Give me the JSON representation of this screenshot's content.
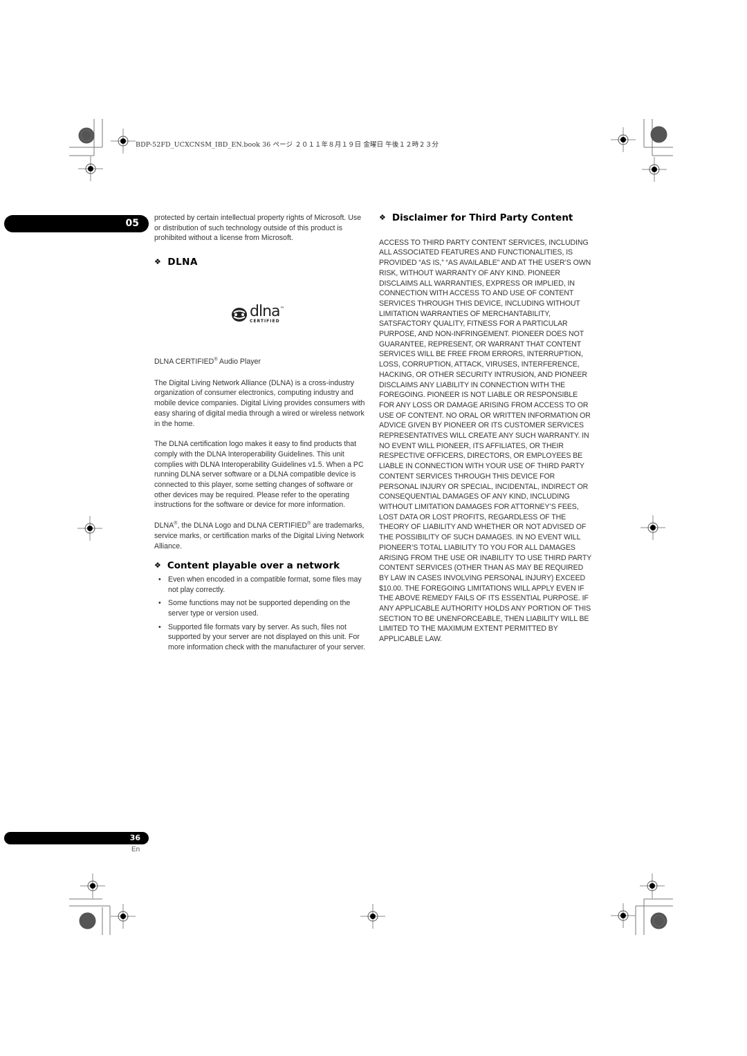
{
  "header": {
    "print_slug": "BDP-52FD_UCXCNSM_IBD_EN.book  36 ページ  ２０１１年８月１９日  金曜日  午後１２時２３分"
  },
  "chapter_tab": {
    "number": "05"
  },
  "footer": {
    "page_number": "36",
    "language": "En"
  },
  "left_column": {
    "intro_paragraph": "protected by certain intellectual property rights of Microsoft. Use or distribution of such technology outside of this product is prohibited without a license from Microsoft.",
    "dlna_section": {
      "heading": "DLNA",
      "logo": {
        "wordmark": "dlna",
        "trademark": "™",
        "subtitle": "CERTIFIED",
        "icon": "dlna-logo-icon"
      },
      "certified_label": "DLNA CERTIFIED",
      "certified_label_mark": "®",
      "certified_label_suffix": " Audio Player",
      "paragraphs": [
        "The Digital Living Network Alliance (DLNA) is a cross-industry organization of consumer electronics, computing industry and mobile device companies. Digital Living provides consumers with easy sharing of digital media through a wired or wireless network in the home.",
        "The DLNA certification logo makes it easy to find products that comply with the DLNA Interoperability Guidelines. This unit complies with DLNA Interoperability Guidelines v1.5. When a PC running DLNA server software or a DLNA compatible device is connected to this player, some setting changes of software or other devices may be required. Please refer to the operating instructions for the software or device for more information."
      ],
      "trademark_note": {
        "part1": "DLNA",
        "mark1": "®",
        "part2": ", the DLNA Logo and DLNA CERTIFIED",
        "mark2": "®",
        "part3": " are trademarks, service marks, or certification marks of the Digital Living Network Alliance."
      }
    },
    "network_section": {
      "heading": "Content playable over a network",
      "bullets": [
        "Even when encoded in a compatible format, some files may not play correctly.",
        "Some functions may not be supported depending on the server type or version used.",
        "Supported file formats vary by server. As such, files not supported by your server are not displayed on this unit. For more information check with the manufacturer of your server."
      ]
    }
  },
  "right_column": {
    "heading": "Disclaimer for Third Party Content",
    "body": "ACCESS TO THIRD PARTY CONTENT SERVICES, INCLUDING ALL ASSOCIATED FEATURES AND FUNCTIONALITIES, IS PROVIDED “AS IS,” “AS AVAILABLE” AND AT THE USER’S OWN RISK, WITHOUT WARRANTY OF ANY KIND. PIONEER DISCLAIMS ALL WARRANTIES, EXPRESS OR IMPLIED, IN CONNECTION WITH ACCESS TO AND USE OF CONTENT SERVICES THROUGH THIS DEVICE, INCLUDING WITHOUT LIMITATION WARRANTIES OF MERCHANTABILITY, SATSFACTORY QUALITY, FITNESS FOR A PARTICULAR PURPOSE, AND NON-INFRINGEMENT. PIONEER DOES NOT GUARANTEE, REPRESENT, OR WARRANT THAT CONTENT SERVICES WILL BE FREE FROM ERRORS, INTERRUPTION, LOSS, CORRUPTION, ATTACK, VIRUSES, INTERFERENCE, HACKING, OR OTHER SECURITY INTRUSION, AND PIONEER DISCLAIMS ANY LIABILITY IN CONNECTION WITH THE FOREGOING. PIONEER IS NOT LIABLE OR RESPONSIBLE FOR ANY LOSS OR DAMAGE ARISING FROM ACCESS TO OR USE OF CONTENT. NO ORAL OR WRITTEN INFORMATION OR ADVICE GIVEN BY PIONEER OR ITS CUSTOMER SERVICES REPRESENTATIVES WILL CREATE ANY SUCH WARRANTY. IN NO EVENT WILL PIONEER, ITS AFFILIATES, OR THEIR RESPECTIVE OFFICERS, DIRECTORS, OR EMPLOYEES BE LIABLE IN CONNECTION WITH YOUR USE OF THIRD PARTY CONTENT SERVICES THROUGH THIS DEVICE FOR PERSONAL INJURY OR SPECIAL, INCIDENTAL, INDIRECT OR CONSEQUENTIAL DAMAGES OF ANY KIND, INCLUDING WITHOUT LIMITATION DAMAGES FOR ATTORNEY’S FEES, LOST DATA OR LOST PROFITS, REGARDLESS OF THE THEORY OF LIABILITY AND WHETHER OR NOT ADVISED OF THE POSSIBILITY OF SUCH DAMAGES. IN NO EVENT WILL PIONEER’S TOTAL LIABILITY TO YOU FOR ALL DAMAGES ARISING FROM THE USE OR INABILITY TO USE THIRD PARTY CONTENT SERVICES (OTHER THAN AS MAY BE REQUIRED BY LAW IN CASES INVOLVING PERSONAL INJURY) EXCEED $10.00. THE FOREGOING LIMITATIONS WILL APPLY EVEN IF THE ABOVE REMEDY FAILS OF ITS ESSENTIAL PURPOSE. IF ANY APPLICABLE AUTHORITY HOLDS ANY PORTION OF THIS SECTION TO BE UNENFORCEABLE, THEN LIABILITY WILL BE LIMITED TO THE MAXIMUM EXTENT PERMITTED BY APPLICABLE LAW."
  },
  "icons": {
    "section_bullet": "❖",
    "registration_mark": "registration-crosshair-icon",
    "color_target": "starburst-target-icon"
  }
}
